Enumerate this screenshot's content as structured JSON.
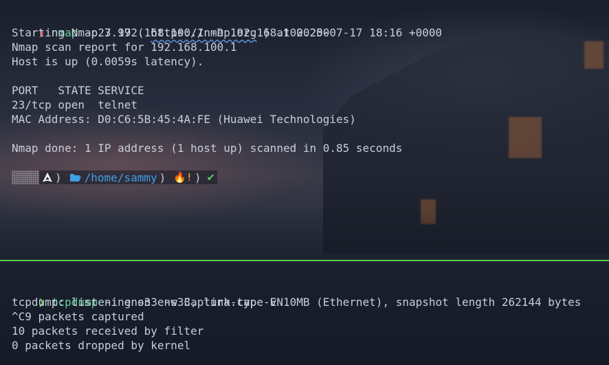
{
  "terminal_top": {
    "prompt_symbol": "❯",
    "command_name": "nmap",
    "command_args": " -p23 192.168.100.1 -D 192.168.100.200",
    "output": {
      "start_prefix": "Starting Nmap 7.97 ( ",
      "start_link": "https://nmap.org",
      "start_suffix": " ) at 2025-07-17 18:16 +0000",
      "report": "Nmap scan report for 192.168.100.1",
      "host_up": "Host is up (0.0059s latency).",
      "table_header": "PORT   STATE SERVICE",
      "table_row": "23/tcp open  telnet",
      "mac": "MAC Address: D0:C6:5B:45:4A:FE (Huawei Technologies)",
      "done": "Nmap done: 1 IP address (1 host up) scanned in 0.85 seconds"
    },
    "powerline": {
      "sep1": ")",
      "path": "/home/sammy",
      "sep2": ")",
      "fire": "🔥!",
      "sep3": ")",
      "check": "✔"
    }
  },
  "terminal_bottom": {
    "prompt_symbol": "❯",
    "command_name": "tcpdump",
    "command_args": " -i ens33 -w Captura.cap -v",
    "output": {
      "listening": "tcpdump: listening on ens33, link-type EN10MB (Ethernet), snapshot length 262144 bytes",
      "captured": "^C9 packets captured",
      "received": "10 packets received by filter",
      "dropped": "0 packets dropped by kernel"
    }
  },
  "colors": {
    "divider": "#58d04a",
    "prompt_red": "#e2474b",
    "prompt_green": "#5fd15a",
    "command": "#62cf9a",
    "path": "#3fa0e8"
  }
}
